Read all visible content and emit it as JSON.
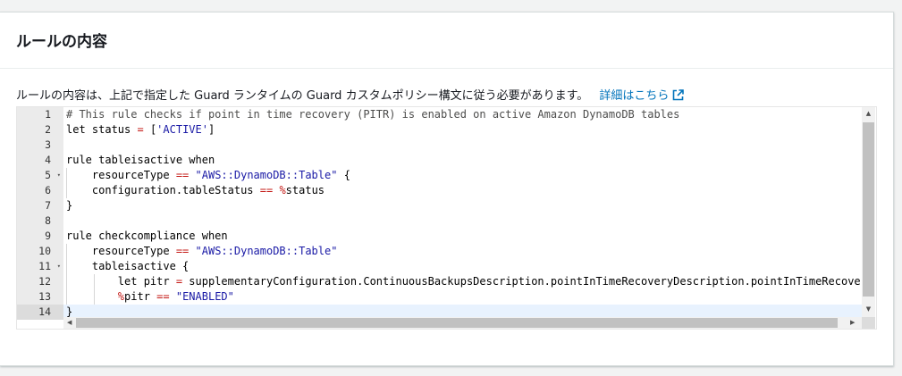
{
  "panel": {
    "title": "ルールの内容",
    "description": "ルールの内容は、上記で指定した Guard ランタイムの Guard カスタムポリシー構文に従う必要があります。",
    "learn_more": "詳細はこちら",
    "learn_more_icon": "external-link-icon",
    "link_color": "#0073bb"
  },
  "editor": {
    "active_line": 14,
    "lines": [
      {
        "n": "1",
        "fold": "",
        "tokens": [
          {
            "t": "# This rule checks if point in time recovery (PITR) is enabled on active Amazon DynamoDB tables",
            "c": "comment"
          }
        ]
      },
      {
        "n": "2",
        "fold": "",
        "tokens": [
          {
            "t": "let status ",
            "c": "plain"
          },
          {
            "t": "=",
            "c": "op"
          },
          {
            "t": " [",
            "c": "plain"
          },
          {
            "t": "'ACTIVE'",
            "c": "string"
          },
          {
            "t": "]",
            "c": "plain"
          }
        ]
      },
      {
        "n": "3",
        "fold": "",
        "tokens": []
      },
      {
        "n": "4",
        "fold": "",
        "tokens": [
          {
            "t": "rule tableisactive when",
            "c": "plain"
          }
        ]
      },
      {
        "n": "5",
        "fold": "▾",
        "tokens": [
          {
            "t": "    resourceType ",
            "c": "plain"
          },
          {
            "t": "==",
            "c": "op"
          },
          {
            "t": " ",
            "c": "plain"
          },
          {
            "t": "\"AWS::DynamoDB::Table\"",
            "c": "string"
          },
          {
            "t": " {",
            "c": "plain"
          }
        ]
      },
      {
        "n": "6",
        "fold": "",
        "tokens": [
          {
            "t": "    configuration.tableStatus ",
            "c": "plain"
          },
          {
            "t": "==",
            "c": "op"
          },
          {
            "t": " ",
            "c": "plain"
          },
          {
            "t": "%",
            "c": "op"
          },
          {
            "t": "status",
            "c": "plain"
          }
        ]
      },
      {
        "n": "7",
        "fold": "",
        "tokens": [
          {
            "t": "}",
            "c": "plain"
          }
        ]
      },
      {
        "n": "8",
        "fold": "",
        "tokens": []
      },
      {
        "n": "9",
        "fold": "",
        "tokens": [
          {
            "t": "rule checkcompliance when",
            "c": "plain"
          }
        ]
      },
      {
        "n": "10",
        "fold": "",
        "tokens": [
          {
            "t": "    resourceType ",
            "c": "plain"
          },
          {
            "t": "==",
            "c": "op"
          },
          {
            "t": " ",
            "c": "plain"
          },
          {
            "t": "\"AWS::DynamoDB::Table\"",
            "c": "string"
          }
        ]
      },
      {
        "n": "11",
        "fold": "▾",
        "tokens": [
          {
            "t": "    tableisactive {",
            "c": "plain"
          }
        ]
      },
      {
        "n": "12",
        "fold": "",
        "tokens": [
          {
            "t": "        let pitr ",
            "c": "plain"
          },
          {
            "t": "=",
            "c": "op"
          },
          {
            "t": " supplementaryConfiguration.ContinuousBackupsDescription.pointInTimeRecoveryDescription.pointInTimeRecoveryStatus",
            "c": "plain"
          }
        ]
      },
      {
        "n": "13",
        "fold": "",
        "tokens": [
          {
            "t": "        ",
            "c": "plain"
          },
          {
            "t": "%",
            "c": "op"
          },
          {
            "t": "pitr ",
            "c": "plain"
          },
          {
            "t": "==",
            "c": "op"
          },
          {
            "t": " ",
            "c": "plain"
          },
          {
            "t": "\"ENABLED\"",
            "c": "string"
          }
        ]
      },
      {
        "n": "14",
        "fold": "",
        "tokens": [
          {
            "t": "}",
            "c": "plain"
          }
        ]
      }
    ]
  },
  "colors": {
    "comment": "#4d4d4c",
    "string": "#1a1aa6",
    "operator": "#c41a16",
    "gutter_bg": "#ebebeb",
    "active_line_bg": "#e8f2fe"
  }
}
